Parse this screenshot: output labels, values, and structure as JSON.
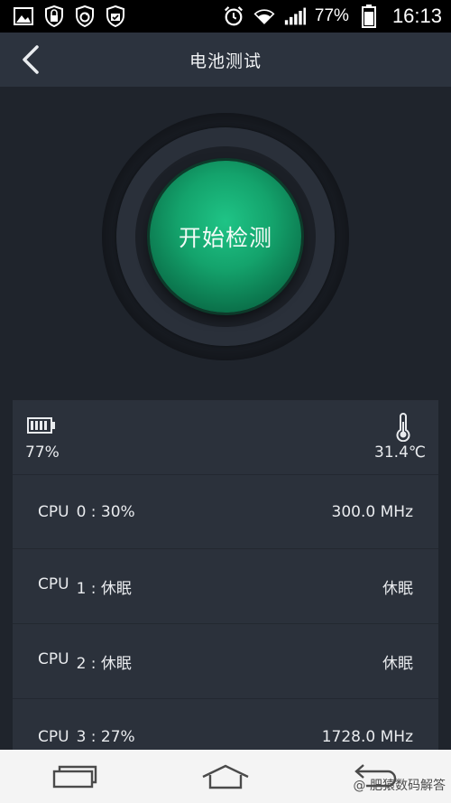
{
  "status_bar": {
    "icons_left": [
      "image-icon",
      "shield-lock-icon",
      "shield-sync-icon",
      "shield-check-icon"
    ],
    "icons_right": [
      "alarm-icon",
      "wifi-icon",
      "signal-icon",
      "battery-icon"
    ],
    "battery_pct": "77%",
    "time": "16:13"
  },
  "header": {
    "title": "电池测试"
  },
  "gauge": {
    "button_label": "开始检测",
    "accent_color": "#14a36c"
  },
  "summary": {
    "battery": "77%",
    "temperature": "31.4℃"
  },
  "cpu_rows": [
    {
      "name": "CPU",
      "index": "0 : 30%",
      "value": "300.0 MHz"
    },
    {
      "name": "CPU",
      "index": "1 : 休眠",
      "value": "休眠"
    },
    {
      "name": "CPU",
      "index": "2 : 休眠",
      "value": "休眠"
    },
    {
      "name": "CPU",
      "index": "3 : 27%",
      "value": "1728.0 MHz"
    }
  ],
  "watermark": "@ 肥猿数码解答"
}
